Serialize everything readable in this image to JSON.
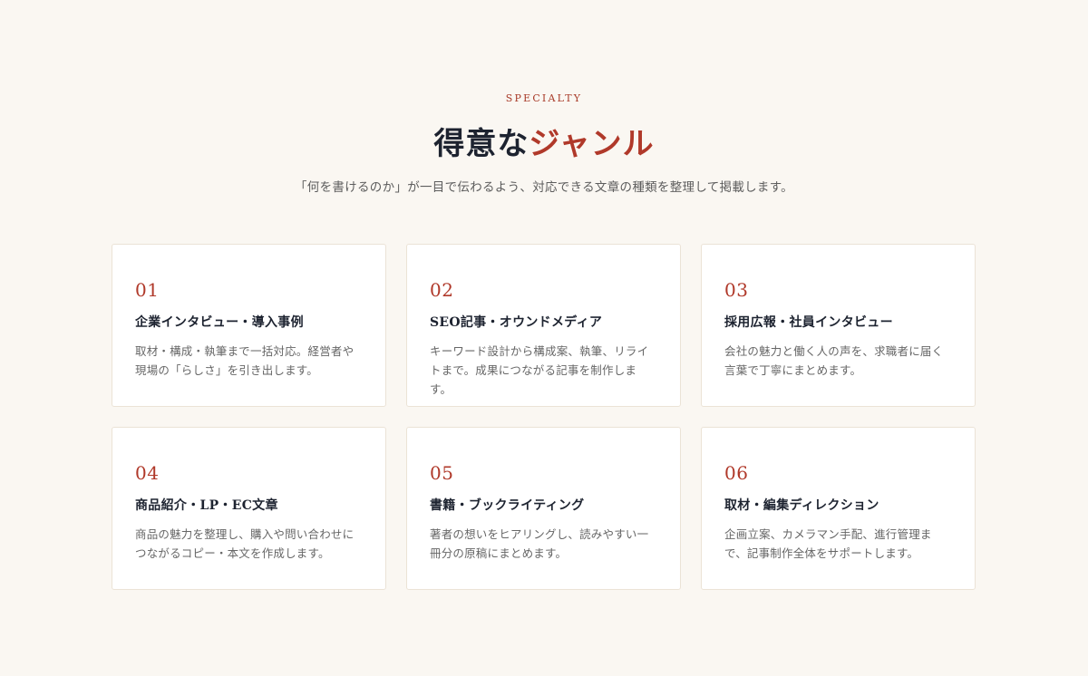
{
  "header": {
    "eyebrow": "SPECIALTY",
    "title_main": "得意な",
    "title_accent": "ジャンル",
    "lead": "「何を書けるのか」が一目で伝わるよう、対応できる文章の種類を整理して掲載します。"
  },
  "cards": [
    {
      "number": "01",
      "title": "企業インタビュー・導入事例",
      "description": "取材・構成・執筆まで一括対応。経営者や現場の「らしさ」を引き出します。"
    },
    {
      "number": "02",
      "title": "SEO記事・オウンドメディア",
      "description": "キーワード設計から構成案、執筆、リライトまで。成果につながる記事を制作します。"
    },
    {
      "number": "03",
      "title": "採用広報・社員インタビュー",
      "description": "会社の魅力と働く人の声を、求職者に届く言葉で丁寧にまとめます。"
    },
    {
      "number": "04",
      "title": "商品紹介・LP・EC文章",
      "description": "商品の魅力を整理し、購入や問い合わせにつながるコピー・本文を作成します。"
    },
    {
      "number": "05",
      "title": "書籍・ブックライティング",
      "description": "著者の想いをヒアリングし、読みやすい一冊分の原稿にまとめます。"
    },
    {
      "number": "06",
      "title": "取材・編集ディレクション",
      "description": "企画立案、カメラマン手配、進行管理まで、記事制作全体をサポートします。"
    }
  ],
  "colors": {
    "background": "#faf7f2",
    "accent": "#b0392a",
    "heading": "#1d2330",
    "card_border": "#ebe3d6"
  }
}
